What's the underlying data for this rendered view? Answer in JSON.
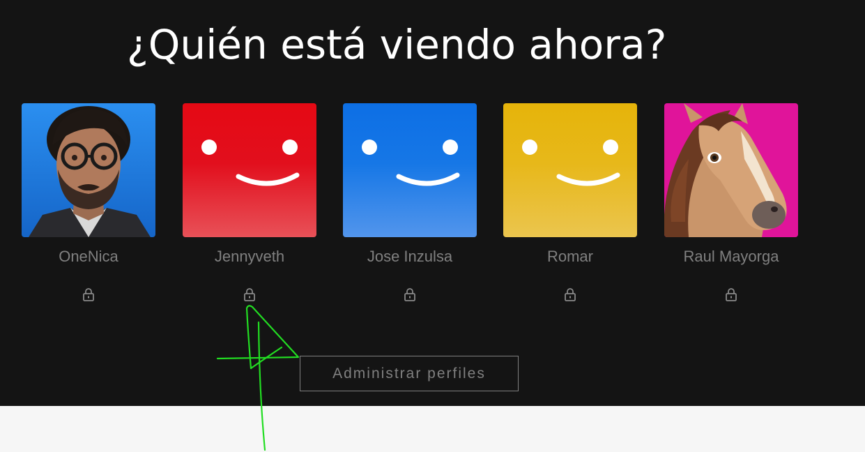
{
  "page": {
    "title": "¿Quién está viendo ahora?",
    "background_dark": "#141414",
    "background_light": "#f6f6f6"
  },
  "profiles": [
    {
      "name": "OneNica",
      "avatar": "photo-portrait-man-glasses",
      "locked": true
    },
    {
      "name": "Jennyveth",
      "avatar": "smiley-red",
      "color": "#e50914",
      "locked": true
    },
    {
      "name": "Jose Inzulsa",
      "avatar": "smiley-blue",
      "color": "#0d6fe5",
      "locked": true
    },
    {
      "name": "Romar",
      "avatar": "smiley-yellow",
      "color": "#e6b40a",
      "locked": true
    },
    {
      "name": "Raul Mayorga",
      "avatar": "cartoon-horse",
      "color": "#e0149a",
      "locked": true
    }
  ],
  "manage_button": {
    "label": "Administrar perfiles"
  },
  "annotation": {
    "description_icon": "green-hand-drawn-arrow",
    "color": "#22dd22"
  }
}
